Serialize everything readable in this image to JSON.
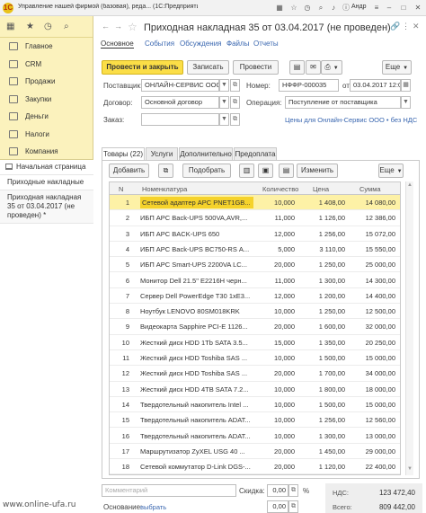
{
  "window": {
    "logo_text": "1C",
    "title": "Управление нашей фирмой (базовая), реда... (1С:Предприятие)",
    "user": "Андр",
    "icons": [
      "grid-icon",
      "star-icon",
      "history-icon",
      "search-icon",
      "bell-icon",
      "info-icon",
      "menu-icon"
    ]
  },
  "sidebar": {
    "items": [
      {
        "label": "Главное",
        "icon": "main-icon"
      },
      {
        "label": "CRM",
        "icon": "crm-icon"
      },
      {
        "label": "Продажи",
        "icon": "sales-icon"
      },
      {
        "label": "Закупки",
        "icon": "purchases-icon"
      },
      {
        "label": "Деньги",
        "icon": "money-icon"
      },
      {
        "label": "Налоги",
        "icon": "taxes-icon"
      },
      {
        "label": "Компания",
        "icon": "company-icon"
      }
    ]
  },
  "open_windows": [
    {
      "label": "Начальная страница"
    },
    {
      "label": "Приходные накладные"
    },
    {
      "label": "Приходная накладная 35 от 03.04.2017 (не проведен) *"
    }
  ],
  "document": {
    "title": "Приходная накладная 35 от 03.04.2017 (не проведен)",
    "nav_tabs": [
      "Основное",
      "События",
      "Обсуждения",
      "Файлы",
      "Отчеты"
    ],
    "buttons": {
      "post_close": "Провести и закрыть",
      "save": "Записать",
      "post": "Провести",
      "more": "Еще"
    },
    "fields": {
      "supplier_label": "Поставщик:",
      "supplier_value": "ОНЛАЙН-СЕРВИС ООО",
      "number_label": "Номер:",
      "number_value": "НФФР-000035",
      "date_label": "от:",
      "date_value": "03.04.2017 12:0",
      "contract_label": "Договор:",
      "contract_value": "Основной договор",
      "operation_label": "Операция:",
      "operation_value": "Поступление от поставщика",
      "order_label": "Заказ:",
      "order_value": "",
      "prices_link": "Цены для Онлайн-Сервис ООО • без НДС"
    },
    "inner_tabs": [
      "Товары (22)",
      "Услуги",
      "Дополнительно",
      "Предоплата"
    ],
    "table_toolbar": {
      "add": "Добавить",
      "pick": "Подобрать",
      "change": "Изменить",
      "more": "Еще"
    },
    "table": {
      "headers": {
        "n": "N",
        "name": "Номенклатура",
        "qty": "Количество",
        "price": "Цена",
        "sum": "Сумма"
      },
      "rows": [
        {
          "n": "1",
          "name": "Сетевой адаптер APC PNET1GB...",
          "qty": "10,000",
          "price": "1 408,00",
          "sum": "14 080,00"
        },
        {
          "n": "2",
          "name": "ИБП APC Back-UPS 500VA,AVR,...",
          "qty": "11,000",
          "price": "1 126,00",
          "sum": "12 386,00"
        },
        {
          "n": "3",
          "name": "ИБП APC BACK-UPS 650",
          "qty": "12,000",
          "price": "1 256,00",
          "sum": "15 072,00"
        },
        {
          "n": "4",
          "name": "ИБП APC Back-UPS BC750-RS А...",
          "qty": "5,000",
          "price": "3 110,00",
          "sum": "15 550,00"
        },
        {
          "n": "5",
          "name": "ИБП APC Smart-UPS 2200VA LC...",
          "qty": "20,000",
          "price": "1 250,00",
          "sum": "25 000,00"
        },
        {
          "n": "6",
          "name": "Монитор Dell 21.5\" E2216H черн...",
          "qty": "11,000",
          "price": "1 300,00",
          "sum": "14 300,00"
        },
        {
          "n": "7",
          "name": "Сервер Dell PowerEdge T30 1xE3...",
          "qty": "12,000",
          "price": "1 200,00",
          "sum": "14 400,00"
        },
        {
          "n": "8",
          "name": "Ноутбук LENOVO 80SM018KRK",
          "qty": "10,000",
          "price": "1 250,00",
          "sum": "12 500,00"
        },
        {
          "n": "9",
          "name": "Видеокарта Sapphire PCI-E 1126...",
          "qty": "20,000",
          "price": "1 600,00",
          "sum": "32 000,00"
        },
        {
          "n": "10",
          "name": "Жесткий диск HDD 1Tb SATA 3.5...",
          "qty": "15,000",
          "price": "1 350,00",
          "sum": "20 250,00"
        },
        {
          "n": "11",
          "name": "Жесткий диск HDD Toshiba SAS ...",
          "qty": "10,000",
          "price": "1 500,00",
          "sum": "15 000,00"
        },
        {
          "n": "12",
          "name": "Жесткий диск HDD Toshiba SAS ...",
          "qty": "20,000",
          "price": "1 700,00",
          "sum": "34 000,00"
        },
        {
          "n": "13",
          "name": "Жесткий диск HDD 4TB SATA 7.2...",
          "qty": "10,000",
          "price": "1 800,00",
          "sum": "18 000,00"
        },
        {
          "n": "14",
          "name": "Твердотельный накопитель Intel ...",
          "qty": "10,000",
          "price": "1 500,00",
          "sum": "15 000,00"
        },
        {
          "n": "15",
          "name": "Твердотельный накопитель ADAT...",
          "qty": "10,000",
          "price": "1 256,00",
          "sum": "12 560,00"
        },
        {
          "n": "16",
          "name": "Твердотельный накопитель ADAT...",
          "qty": "10,000",
          "price": "1 300,00",
          "sum": "13 000,00"
        },
        {
          "n": "17",
          "name": "Маршрутизатор ZyXEL USG 40 ...",
          "qty": "20,000",
          "price": "1 450,00",
          "sum": "29 000,00"
        },
        {
          "n": "18",
          "name": "Сетевой коммутатор D-Link DGS-...",
          "qty": "20,000",
          "price": "1 120,00",
          "sum": "22 400,00"
        },
        {
          "n": "19",
          "name": "Сетевой коммутатор D-Link DGS...",
          "qty": "10,000",
          "price": "1 300,00",
          "sum": "13 000,00"
        }
      ]
    },
    "footer": {
      "comment_placeholder": "Комментарий",
      "discount_label": "Скидка:",
      "discount_value": "0,00",
      "percent_sign": "%",
      "basis_label": "Основание:",
      "basis_link": "выбрать",
      "basis_value": "0,00",
      "vat_label": "НДС:",
      "vat_value": "123 472,40",
      "total_label": "Всего:",
      "total_value": "809 442,00"
    }
  },
  "watermark": "www.online-ufa.ru"
}
